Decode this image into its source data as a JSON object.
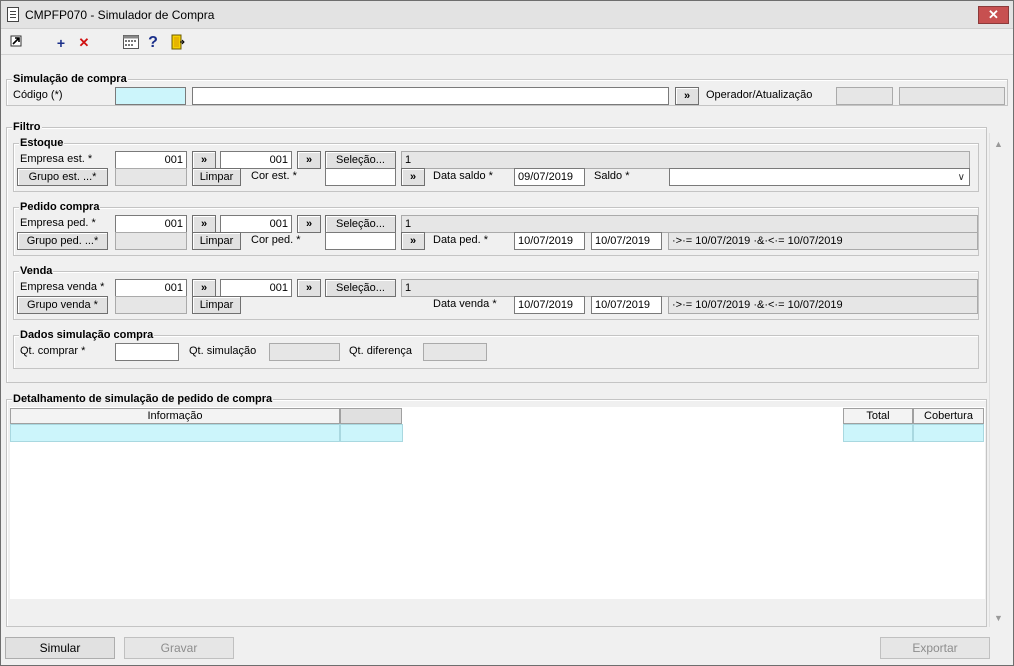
{
  "window": {
    "title": "CMPFP070 - Simulador de Compra",
    "close_label": "✕"
  },
  "toolbar": {
    "icons": [
      "exit-icon",
      "add-icon",
      "delete-icon",
      "calendar-icon",
      "help-icon",
      "door-icon"
    ],
    "add_glyph": "+",
    "delete_glyph": "✕",
    "help_glyph": "?"
  },
  "simulacao": {
    "title": "Simulação de compra",
    "codigo_label": "Código (*)",
    "codigo_value": "",
    "descricao_value": "",
    "lookup_label": "»",
    "operador_label": "Operador/Atualização",
    "operador_value": "",
    "atualizacao_value": ""
  },
  "filtro": {
    "title": "Filtro",
    "estoque": {
      "title": "Estoque",
      "empresa_label": "Empresa est. *",
      "empresa_de": "001",
      "empresa_ate": "001",
      "selecao_label": "Seleção...",
      "selecao_value": "1",
      "grupo_label": "Grupo est. ...*",
      "grupo_value": "",
      "limpar_label": "Limpar",
      "cor_label": "Cor est. *",
      "cor_value": "",
      "data_label": "Data saldo *",
      "data_value": "09/07/2019",
      "saldo_label": "Saldo *",
      "saldo_value": ""
    },
    "pedido": {
      "title": "Pedido compra",
      "empresa_label": "Empresa ped. *",
      "empresa_de": "001",
      "empresa_ate": "001",
      "selecao_label": "Seleção...",
      "selecao_value": "1",
      "grupo_label": "Grupo ped. ...*",
      "grupo_value": "",
      "limpar_label": "Limpar",
      "cor_label": "Cor ped. *",
      "cor_value": "",
      "data_label": "Data ped. *",
      "data_de": "10/07/2019",
      "data_ate": "10/07/2019",
      "range_text": "·>·= 10/07/2019 ·&·<·= 10/07/2019"
    },
    "venda": {
      "title": "Venda",
      "empresa_label": "Empresa venda *",
      "empresa_de": "001",
      "empresa_ate": "001",
      "selecao_label": "Seleção...",
      "selecao_value": "1",
      "grupo_label": "Grupo venda *",
      "grupo_value": "",
      "limpar_label": "Limpar",
      "data_label": "Data venda *",
      "data_de": "10/07/2019",
      "data_ate": "10/07/2019",
      "range_text": "·>·= 10/07/2019 ·&·<·= 10/07/2019"
    },
    "dados": {
      "title": "Dados simulação compra",
      "qt_comprar_label": "Qt. comprar *",
      "qt_comprar_value": "",
      "qt_simulacao_label": "Qt. simulação",
      "qt_simulacao_value": "",
      "qt_diferenca_label": "Qt. diferença",
      "qt_diferenca_value": ""
    }
  },
  "detalhamento": {
    "title": "Detalhamento de simulação de pedido de compra",
    "columns": [
      "Informação",
      "",
      "Total",
      "Cobertura"
    ]
  },
  "footer": {
    "simular_label": "Simular",
    "gravar_label": "Gravar",
    "exportar_label": "Exportar"
  }
}
